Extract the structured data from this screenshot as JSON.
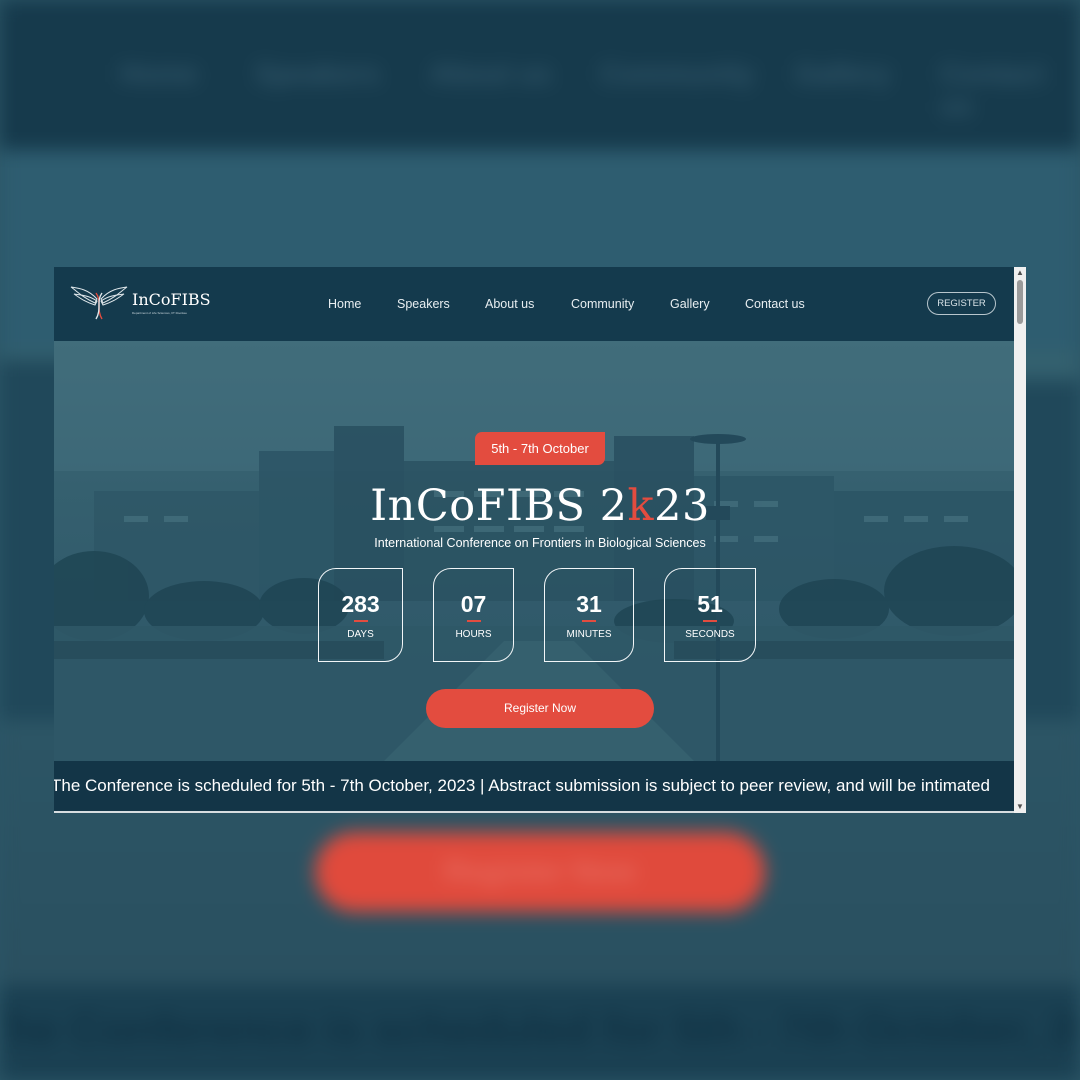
{
  "site": {
    "logo_text": "InCoFIBS",
    "logo_subtext": "Department of Life Sciences, IIT Roorkee",
    "nav": [
      "Home",
      "Speakers",
      "About us",
      "Community",
      "Gallery",
      "Contact us"
    ],
    "register_button": "REGISTER"
  },
  "hero": {
    "date_badge": "5th - 7th October",
    "title_prefix": "InCoFIBS 2",
    "title_accent": "k",
    "title_suffix": "23",
    "subtitle": "International Conference on Frontiers in Biological Sciences",
    "countdown": [
      {
        "value": "283",
        "label": "DAYS"
      },
      {
        "value": "07",
        "label": "HOURS"
      },
      {
        "value": "31",
        "label": "MINUTES"
      },
      {
        "value": "51",
        "label": "SECONDS"
      }
    ],
    "cta": "Register Now"
  },
  "ticker": {
    "text": "The Conference is scheduled for 5th - 7th October, 2023 | Abstract submission is subject to peer review, and will be intimated"
  },
  "colors": {
    "navy": "#143a4d",
    "accent": "#e34c3f",
    "hero_overlay": "#35606f"
  },
  "icons": {
    "logo": "winged-dna-icon",
    "scroll_up": "triangle-up-icon",
    "scroll_down": "triangle-down-icon"
  }
}
